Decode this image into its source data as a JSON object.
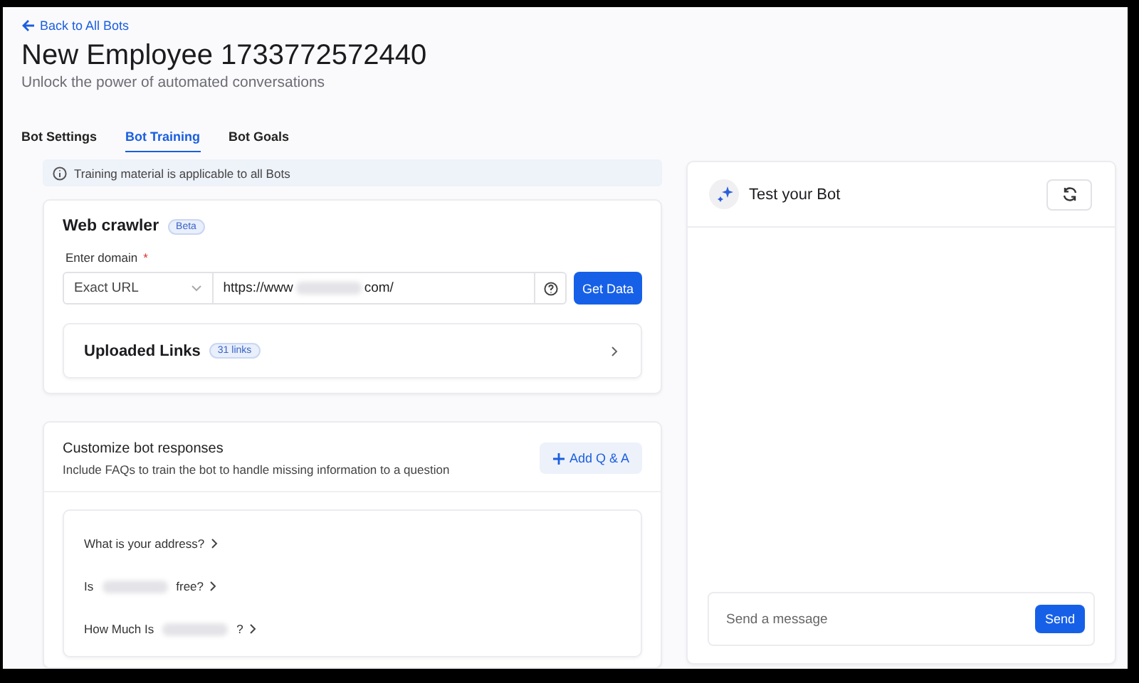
{
  "back_link": "Back to All Bots",
  "title": "New Employee 1733772572440",
  "subtitle": "Unlock the power of automated conversations",
  "tabs": [
    {
      "label": "Bot Settings",
      "selected": false
    },
    {
      "label": "Bot Training",
      "selected": true
    },
    {
      "label": "Bot Goals",
      "selected": false
    }
  ],
  "notice": "Training material is applicable to all Bots",
  "web_crawler": {
    "title": "Web crawler",
    "badge": "Beta",
    "field_label": "Enter domain",
    "required_mark": "*",
    "match_type": "Exact URL",
    "url": [
      {
        "kind": "text",
        "text": "https://www"
      },
      {
        "kind": "redacted"
      },
      {
        "kind": "text",
        "text": "com/"
      }
    ],
    "button": "Get Data",
    "uploaded": {
      "title": "Uploaded Links",
      "count": "31 links"
    }
  },
  "responses": {
    "title": "Customize bot responses",
    "description": "Include FAQs to train the bot to handle missing information to a question",
    "add_button": "Add Q & A",
    "questions": [
      [
        {
          "kind": "text",
          "text": "What is your address?"
        }
      ],
      [
        {
          "kind": "text",
          "text": "Is"
        },
        {
          "kind": "redacted"
        },
        {
          "kind": "text",
          "text": "free?"
        }
      ],
      [
        {
          "kind": "text",
          "text": "How Much Is"
        },
        {
          "kind": "redacted"
        },
        {
          "kind": "text",
          "text": "?"
        }
      ]
    ]
  },
  "test_panel": {
    "title": "Test your Bot",
    "placeholder": "Send a message",
    "send": "Send"
  }
}
